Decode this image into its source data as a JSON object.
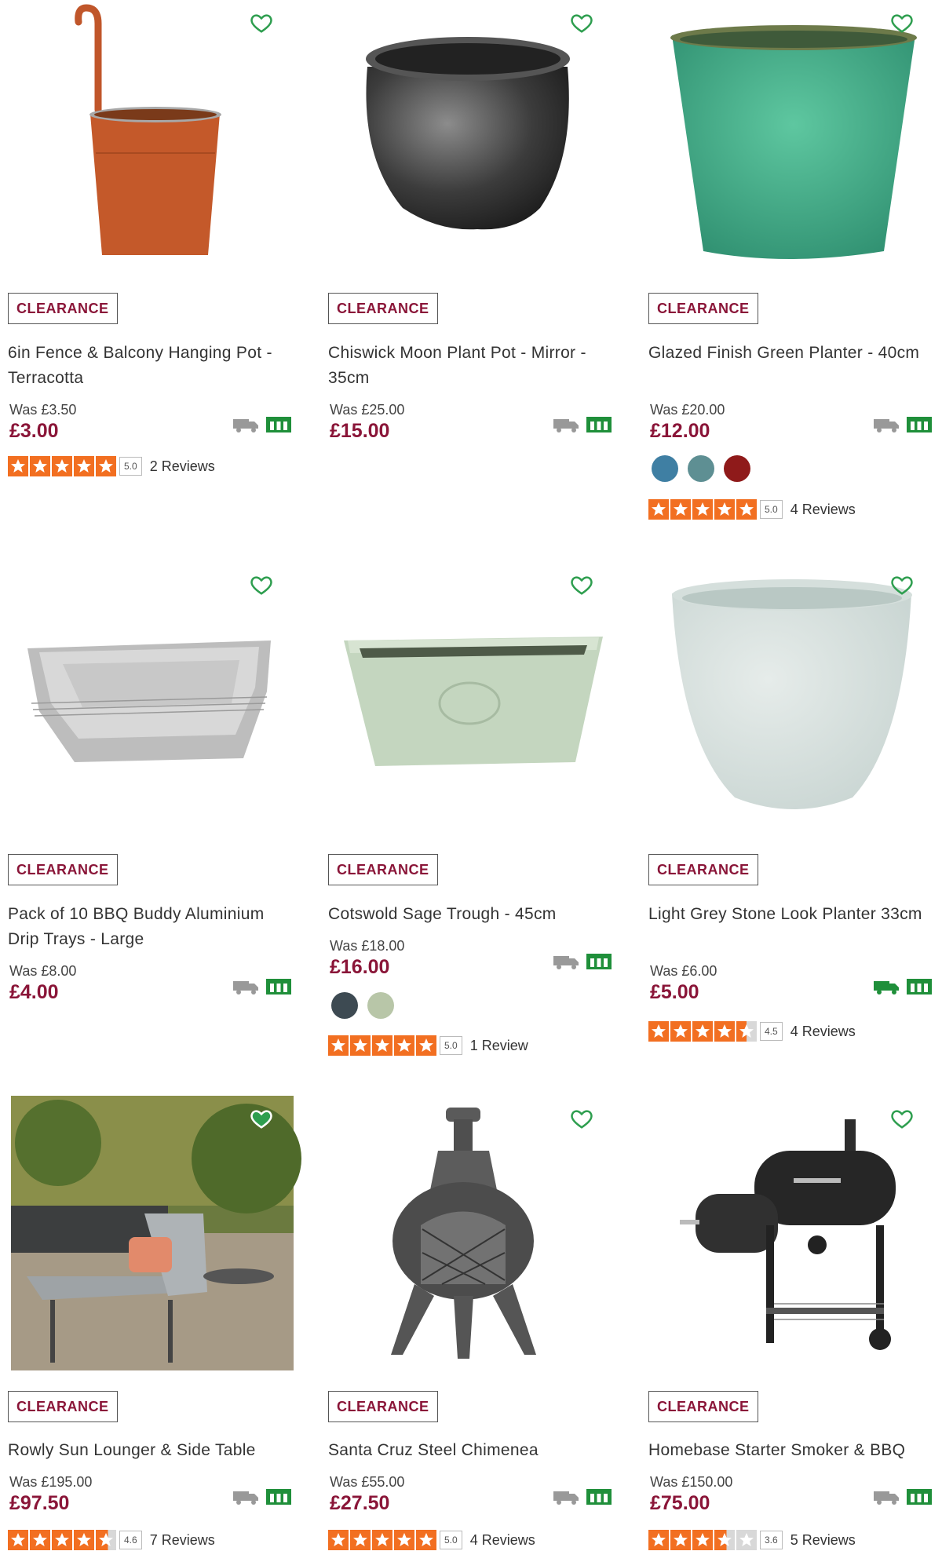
{
  "badge_label": "CLEARANCE",
  "colors": {
    "price": "#8a1538",
    "star": "#f26f21",
    "heart": "#2e9e4f",
    "click_collect": "#1f8f3a"
  },
  "products": [
    {
      "title": "6in Fence & Balcony Hanging Pot - Terracotta",
      "was": "Was £3.50",
      "price": "£3.00",
      "rating_score": "5.0",
      "rating_value": 5.0,
      "reviews": "2 Reviews",
      "swatches": [],
      "delivery_available": false
    },
    {
      "title": "Chiswick Moon Plant Pot - Mirror - 35cm",
      "was": "Was £25.00",
      "price": "£15.00",
      "rating_score": "",
      "rating_value": null,
      "reviews": "",
      "swatches": [],
      "delivery_available": false
    },
    {
      "title": "Glazed Finish Green Planter - 40cm",
      "was": "Was £20.00",
      "price": "£12.00",
      "rating_score": "5.0",
      "rating_value": 5.0,
      "reviews": "4 Reviews",
      "swatches": [
        "#3f7fa3",
        "#5e8f93",
        "#8f1a1a"
      ],
      "delivery_available": false
    },
    {
      "title": "Pack of 10 BBQ Buddy Aluminium Drip Trays - Large",
      "was": "Was £8.00",
      "price": "£4.00",
      "rating_score": "",
      "rating_value": null,
      "reviews": "",
      "swatches": [],
      "delivery_available": false
    },
    {
      "title": "Cotswold Sage Trough - 45cm",
      "was": "Was £18.00",
      "price": "£16.00",
      "rating_score": "5.0",
      "rating_value": 5.0,
      "reviews": "1 Review",
      "swatches": [
        "#3d4a52",
        "#b8c6a8"
      ],
      "delivery_available": false
    },
    {
      "title": "Light Grey Stone Look Planter 33cm",
      "was": "Was £6.00",
      "price": "£5.00",
      "rating_score": "4.5",
      "rating_value": 4.5,
      "reviews": "4 Reviews",
      "swatches": [],
      "delivery_available": true
    },
    {
      "title": "Rowly Sun Lounger & Side Table",
      "was": "Was £195.00",
      "price": "£97.50",
      "rating_score": "4.6",
      "rating_value": 4.6,
      "reviews": "7 Reviews",
      "swatches": [],
      "delivery_available": false
    },
    {
      "title": "Santa Cruz Steel Chimenea",
      "was": "Was £55.00",
      "price": "£27.50",
      "rating_score": "5.0",
      "rating_value": 5.0,
      "reviews": "4 Reviews",
      "swatches": [],
      "delivery_available": false
    },
    {
      "title": "Homebase Starter Smoker & BBQ",
      "was": "Was £150.00",
      "price": "£75.00",
      "rating_score": "3.6",
      "rating_value": 3.6,
      "reviews": "5 Reviews",
      "swatches": [],
      "delivery_available": false
    }
  ]
}
